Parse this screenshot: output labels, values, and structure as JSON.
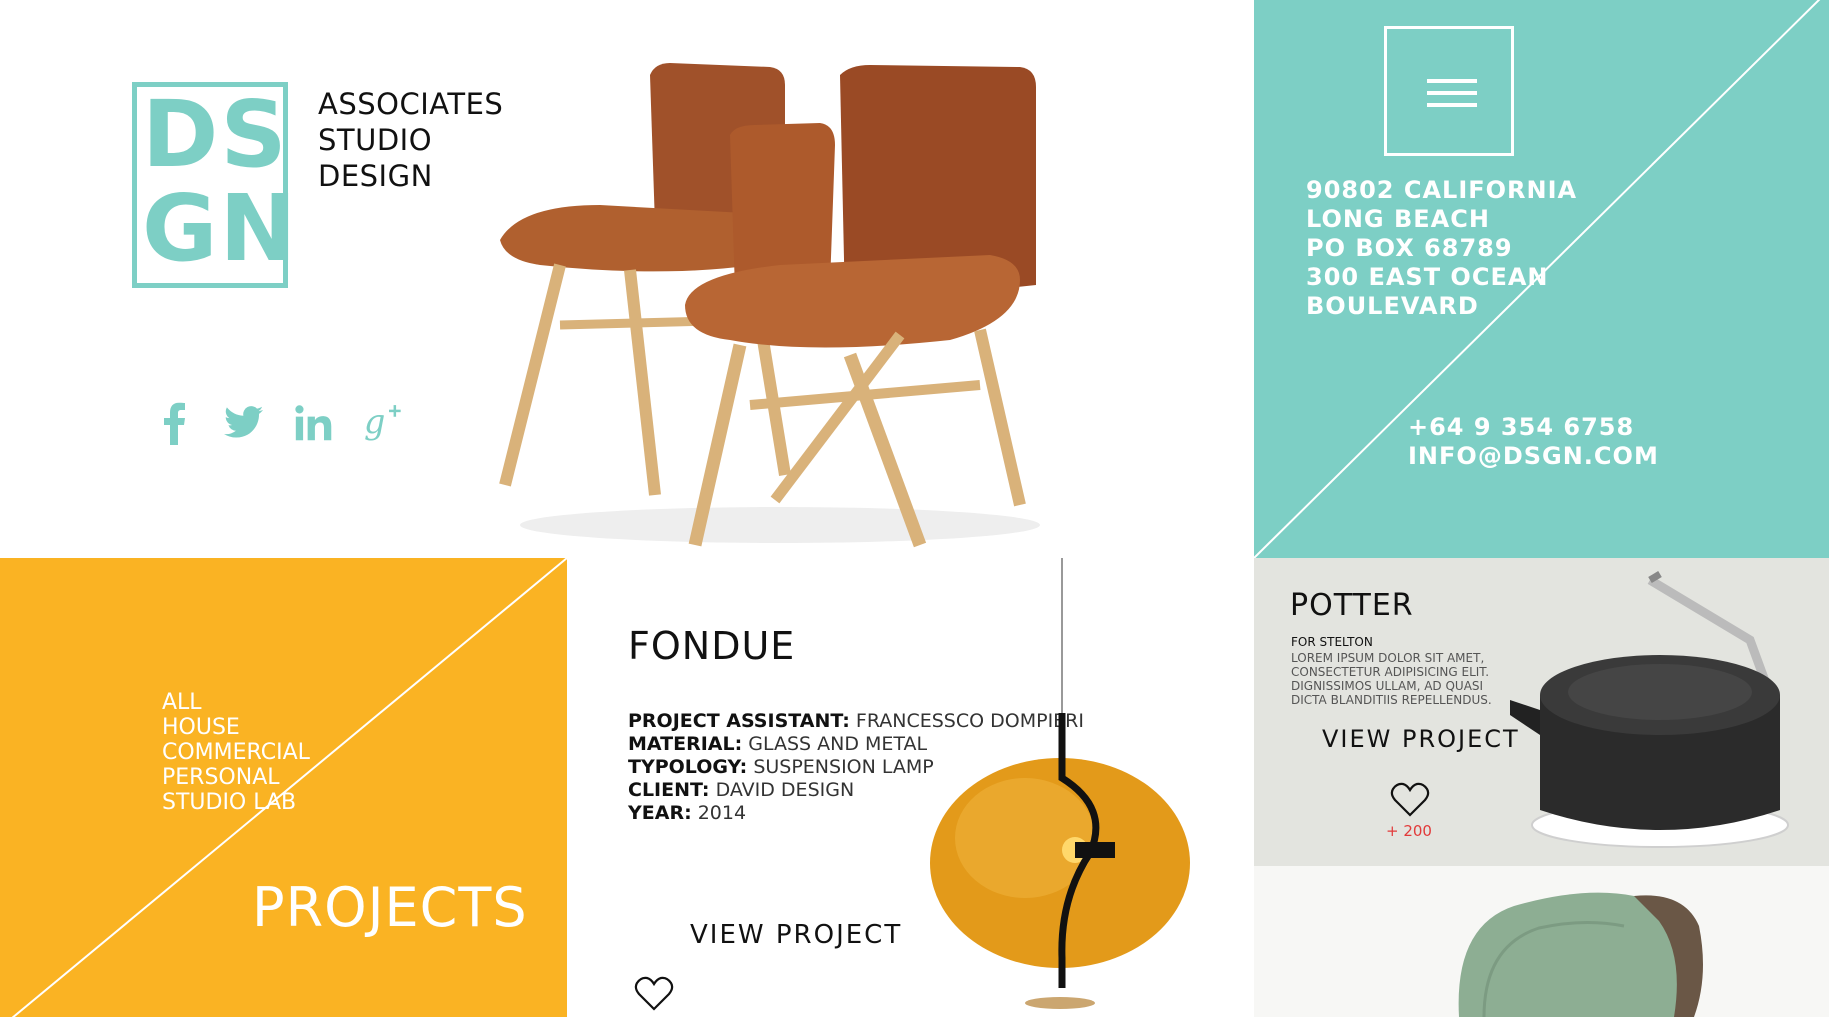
{
  "brand": {
    "logo_letters": [
      "DS",
      "GN"
    ],
    "tagline": [
      "ASSOCIATES",
      "STUDIO",
      "DESIGN"
    ]
  },
  "social": [
    "facebook-icon",
    "twitter-icon",
    "linkedin-icon",
    "google-plus-icon"
  ],
  "contact": {
    "address": [
      "90802 CALIFORNIA",
      "LONG BEACH",
      "PO BOX 68789",
      "300 EAST OCEAN",
      "BOULEVARD"
    ],
    "phone": "+64 9 354 6758",
    "email": "INFO@DSGN.COM"
  },
  "projects": {
    "categories": [
      "ALL",
      "HOUSE",
      "COMMERCIAL",
      "PERSONAL",
      "STUDIO LAB"
    ],
    "title": "PROJECTS"
  },
  "fondue": {
    "title": "FONDUE",
    "meta": [
      {
        "label": "PROJECT ASSISTANT:",
        "value": "FRANCESSCO DOMPIERI"
      },
      {
        "label": "MATERIAL:",
        "value": "GLASS AND METAL"
      },
      {
        "label": "TYPOLOGY:",
        "value": "SUSPENSION LAMP"
      },
      {
        "label": "CLIENT:",
        "value": "DAVID DESIGN"
      },
      {
        "label": "YEAR:",
        "value": "2014"
      }
    ],
    "cta": "VIEW PROJECT"
  },
  "potter": {
    "title": "POTTER",
    "for": "FOR STELTON",
    "description": "LOREM IPSUM DOLOR SIT AMET, CONSECTETUR ADIPISICING ELIT. DIGNISSIMOS ULLAM, AD QUASI DICTA BLANDITIIS REPELLENDUS.",
    "cta": "VIEW PROJECT",
    "likes": "+ 200"
  },
  "colors": {
    "teal": "#7dcfc5",
    "orange": "#fab323",
    "likes_red": "#e23a3a"
  }
}
